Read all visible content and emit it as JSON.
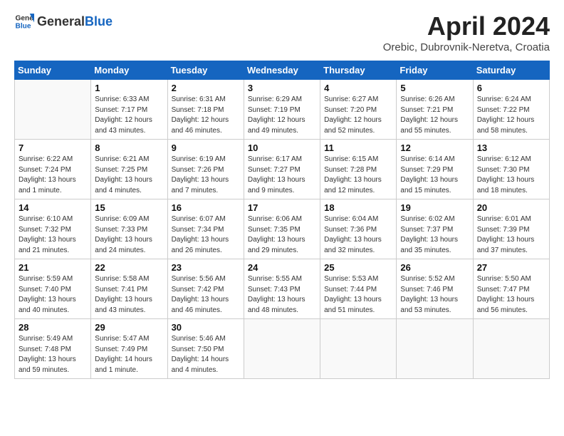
{
  "header": {
    "logo_general": "General",
    "logo_blue": "Blue",
    "month_title": "April 2024",
    "location": "Orebic, Dubrovnik-Neretva, Croatia"
  },
  "weekdays": [
    "Sunday",
    "Monday",
    "Tuesday",
    "Wednesday",
    "Thursday",
    "Friday",
    "Saturday"
  ],
  "weeks": [
    [
      {
        "day": "",
        "info": ""
      },
      {
        "day": "1",
        "info": "Sunrise: 6:33 AM\nSunset: 7:17 PM\nDaylight: 12 hours\nand 43 minutes."
      },
      {
        "day": "2",
        "info": "Sunrise: 6:31 AM\nSunset: 7:18 PM\nDaylight: 12 hours\nand 46 minutes."
      },
      {
        "day": "3",
        "info": "Sunrise: 6:29 AM\nSunset: 7:19 PM\nDaylight: 12 hours\nand 49 minutes."
      },
      {
        "day": "4",
        "info": "Sunrise: 6:27 AM\nSunset: 7:20 PM\nDaylight: 12 hours\nand 52 minutes."
      },
      {
        "day": "5",
        "info": "Sunrise: 6:26 AM\nSunset: 7:21 PM\nDaylight: 12 hours\nand 55 minutes."
      },
      {
        "day": "6",
        "info": "Sunrise: 6:24 AM\nSunset: 7:22 PM\nDaylight: 12 hours\nand 58 minutes."
      }
    ],
    [
      {
        "day": "7",
        "info": "Sunrise: 6:22 AM\nSunset: 7:24 PM\nDaylight: 13 hours\nand 1 minute."
      },
      {
        "day": "8",
        "info": "Sunrise: 6:21 AM\nSunset: 7:25 PM\nDaylight: 13 hours\nand 4 minutes."
      },
      {
        "day": "9",
        "info": "Sunrise: 6:19 AM\nSunset: 7:26 PM\nDaylight: 13 hours\nand 7 minutes."
      },
      {
        "day": "10",
        "info": "Sunrise: 6:17 AM\nSunset: 7:27 PM\nDaylight: 13 hours\nand 9 minutes."
      },
      {
        "day": "11",
        "info": "Sunrise: 6:15 AM\nSunset: 7:28 PM\nDaylight: 13 hours\nand 12 minutes."
      },
      {
        "day": "12",
        "info": "Sunrise: 6:14 AM\nSunset: 7:29 PM\nDaylight: 13 hours\nand 15 minutes."
      },
      {
        "day": "13",
        "info": "Sunrise: 6:12 AM\nSunset: 7:30 PM\nDaylight: 13 hours\nand 18 minutes."
      }
    ],
    [
      {
        "day": "14",
        "info": "Sunrise: 6:10 AM\nSunset: 7:32 PM\nDaylight: 13 hours\nand 21 minutes."
      },
      {
        "day": "15",
        "info": "Sunrise: 6:09 AM\nSunset: 7:33 PM\nDaylight: 13 hours\nand 24 minutes."
      },
      {
        "day": "16",
        "info": "Sunrise: 6:07 AM\nSunset: 7:34 PM\nDaylight: 13 hours\nand 26 minutes."
      },
      {
        "day": "17",
        "info": "Sunrise: 6:06 AM\nSunset: 7:35 PM\nDaylight: 13 hours\nand 29 minutes."
      },
      {
        "day": "18",
        "info": "Sunrise: 6:04 AM\nSunset: 7:36 PM\nDaylight: 13 hours\nand 32 minutes."
      },
      {
        "day": "19",
        "info": "Sunrise: 6:02 AM\nSunset: 7:37 PM\nDaylight: 13 hours\nand 35 minutes."
      },
      {
        "day": "20",
        "info": "Sunrise: 6:01 AM\nSunset: 7:39 PM\nDaylight: 13 hours\nand 37 minutes."
      }
    ],
    [
      {
        "day": "21",
        "info": "Sunrise: 5:59 AM\nSunset: 7:40 PM\nDaylight: 13 hours\nand 40 minutes."
      },
      {
        "day": "22",
        "info": "Sunrise: 5:58 AM\nSunset: 7:41 PM\nDaylight: 13 hours\nand 43 minutes."
      },
      {
        "day": "23",
        "info": "Sunrise: 5:56 AM\nSunset: 7:42 PM\nDaylight: 13 hours\nand 46 minutes."
      },
      {
        "day": "24",
        "info": "Sunrise: 5:55 AM\nSunset: 7:43 PM\nDaylight: 13 hours\nand 48 minutes."
      },
      {
        "day": "25",
        "info": "Sunrise: 5:53 AM\nSunset: 7:44 PM\nDaylight: 13 hours\nand 51 minutes."
      },
      {
        "day": "26",
        "info": "Sunrise: 5:52 AM\nSunset: 7:46 PM\nDaylight: 13 hours\nand 53 minutes."
      },
      {
        "day": "27",
        "info": "Sunrise: 5:50 AM\nSunset: 7:47 PM\nDaylight: 13 hours\nand 56 minutes."
      }
    ],
    [
      {
        "day": "28",
        "info": "Sunrise: 5:49 AM\nSunset: 7:48 PM\nDaylight: 13 hours\nand 59 minutes."
      },
      {
        "day": "29",
        "info": "Sunrise: 5:47 AM\nSunset: 7:49 PM\nDaylight: 14 hours\nand 1 minute."
      },
      {
        "day": "30",
        "info": "Sunrise: 5:46 AM\nSunset: 7:50 PM\nDaylight: 14 hours\nand 4 minutes."
      },
      {
        "day": "",
        "info": ""
      },
      {
        "day": "",
        "info": ""
      },
      {
        "day": "",
        "info": ""
      },
      {
        "day": "",
        "info": ""
      }
    ]
  ]
}
